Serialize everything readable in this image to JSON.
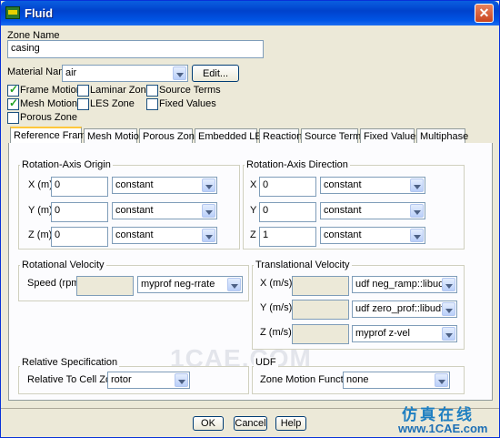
{
  "window": {
    "title": "Fluid",
    "close_glyph": "✕"
  },
  "zone_name": {
    "label": "Zone Name",
    "value": "casing"
  },
  "material": {
    "label": "Material Name",
    "value": "air",
    "edit_button": "Edit..."
  },
  "options": {
    "frame_motion": {
      "label": "Frame Motion",
      "checked": true
    },
    "laminar_zone": {
      "label": "Laminar Zone",
      "checked": false
    },
    "source_terms": {
      "label": "Source Terms",
      "checked": false
    },
    "mesh_motion": {
      "label": "Mesh Motion",
      "checked": true
    },
    "les_zone": {
      "label": "LES Zone",
      "checked": false
    },
    "fixed_values": {
      "label": "Fixed Values",
      "checked": false
    },
    "porous_zone": {
      "label": "Porous Zone",
      "checked": false
    }
  },
  "tabs": [
    "Reference Frame",
    "Mesh Motion",
    "Porous Zone",
    "Embedded LES",
    "Reaction",
    "Source Terms",
    "Fixed Values",
    "Multiphase"
  ],
  "active_tab": "Reference Frame",
  "rotation_origin": {
    "title": "Rotation-Axis Origin",
    "rows": [
      {
        "label": "X (m)",
        "value": "0",
        "method": "constant"
      },
      {
        "label": "Y (m)",
        "value": "0",
        "method": "constant"
      },
      {
        "label": "Z (m)",
        "value": "0",
        "method": "constant"
      }
    ]
  },
  "rotation_direction": {
    "title": "Rotation-Axis Direction",
    "rows": [
      {
        "label": "X",
        "value": "0",
        "method": "constant"
      },
      {
        "label": "Y",
        "value": "0",
        "method": "constant"
      },
      {
        "label": "Z",
        "value": "1",
        "method": "constant"
      }
    ]
  },
  "rotational_velocity": {
    "title": "Rotational Velocity",
    "speed_label": "Speed (rpm)",
    "speed_value": "",
    "profile": "myprof neg-rrate"
  },
  "translational_velocity": {
    "title": "Translational Velocity",
    "rows": [
      {
        "label": "X (m/s)",
        "value": "",
        "profile": "udf neg_ramp::libudf"
      },
      {
        "label": "Y (m/s)",
        "value": "",
        "profile": "udf zero_prof::libudf"
      },
      {
        "label": "Z (m/s)",
        "value": "",
        "profile": "myprof z-vel"
      }
    ]
  },
  "relative_spec": {
    "title": "Relative Specification",
    "label": "Relative To Cell Zone",
    "value": "rotor"
  },
  "udf": {
    "title": "UDF",
    "label": "Zone Motion Function",
    "value": "none"
  },
  "buttons": {
    "ok": "OK",
    "cancel": "Cancel",
    "help": "Help"
  },
  "watermark": "1CAE.COM",
  "brand": {
    "chinese": "仿真在线",
    "url": "www.1CAE.com"
  },
  "colors": {
    "title_bar": "#0055e6",
    "dialog_bg": "#ece9d8",
    "active_tab_accent": "#ffc83c",
    "brand": "#1e7fc1"
  }
}
